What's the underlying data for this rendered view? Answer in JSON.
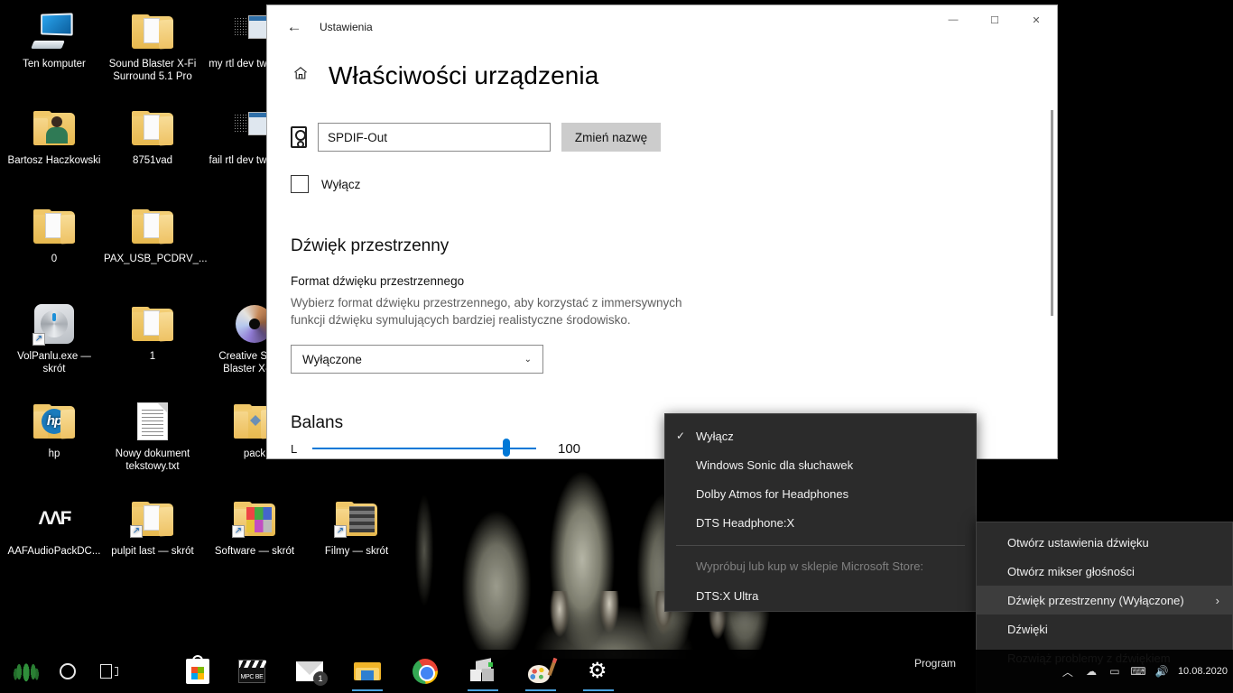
{
  "desktop": {
    "icons": [
      {
        "label": "Ten komputer",
        "type": "pc"
      },
      {
        "label": "Sound Blaster X-Fi Surround 5.1 Pro",
        "type": "folder-papers"
      },
      {
        "label": "my rtl dev tweak.jpg",
        "type": "jpg"
      },
      {
        "label": "Bartosz Haczkowski",
        "type": "folder-person"
      },
      {
        "label": "8751vad",
        "type": "folder-papers"
      },
      {
        "label": "fail  rtl dev tweak.jpg",
        "type": "jpg"
      },
      {
        "label": "0",
        "type": "folder-papers"
      },
      {
        "label": "PAX_USB_PCDRV_...",
        "type": "folder-papers"
      },
      {
        "label": "VolPanlu.exe — skrót",
        "type": "knob-shortcut"
      },
      {
        "label": "1",
        "type": "folder-papers"
      },
      {
        "label": "Creative Sound Blaster X-Fi...",
        "type": "disc"
      },
      {
        "label": "hp",
        "type": "folder-hp"
      },
      {
        "label": "Nowy dokument tekstowy.txt",
        "type": "text"
      },
      {
        "label": "pack",
        "type": "folder-pack"
      },
      {
        "label": "AAFAudioPackDC...",
        "type": "aaf"
      },
      {
        "label": "pulpit last — skrót",
        "type": "folder-shortcut"
      },
      {
        "label": "Software — skrót",
        "type": "folder-color-shortcut"
      },
      {
        "label": "Filmy — skrót",
        "type": "folder-film-shortcut"
      }
    ]
  },
  "settings_window": {
    "title": "Ustawienia",
    "back_icon": "←",
    "home_icon": "home-icon",
    "page_title": "Właściwości urządzenia",
    "minimize_label": "—",
    "maximize_label": "☐",
    "close_label": "✕",
    "device_name_value": "SPDIF-Out",
    "rename_button": "Zmień nazwę",
    "disable_checkbox_label": "Wyłącz",
    "spatial_section_title": "Dźwięk przestrzenny",
    "spatial_field_label": "Format dźwięku przestrzennego",
    "spatial_description": "Wybierz format dźwięku przestrzennego, aby korzystać z immersywnych funkcji dźwięku symulujących bardziej realistyczne środowisko.",
    "spatial_dropdown_value": "Wyłączone",
    "spatial_dropdown_chevron": "⌄",
    "balance_title": "Balans",
    "balance_left_label": "L",
    "balance_value": "100"
  },
  "spatial_menu": {
    "checkmark": "✓",
    "items": [
      {
        "label": "Wyłącz",
        "checked": true
      },
      {
        "label": "Windows Sonic dla słuchawek",
        "checked": false
      },
      {
        "label": "Dolby Atmos for Headphones",
        "checked": false
      },
      {
        "label": "DTS Headphone:X",
        "checked": false
      }
    ],
    "store_header": "Wypróbuj lub kup w sklepie Microsoft Store:",
    "store_items": [
      {
        "label": "DTS:X Ultra"
      }
    ]
  },
  "tray_menu": {
    "items": [
      {
        "label": "Otwórz ustawienia dźwięku",
        "selected": false,
        "submenu": false
      },
      {
        "label": "Otwórz mikser głośności",
        "selected": false,
        "submenu": false
      },
      {
        "label": "Dźwięk przestrzenny (Wyłączone)",
        "selected": true,
        "submenu": true
      },
      {
        "label": "Dźwięki",
        "selected": false,
        "submenu": false
      },
      {
        "label": "Rozwiąż problemy z dźwiękiem",
        "selected": false,
        "submenu": false
      }
    ],
    "submenu_arrow": "›"
  },
  "taskbar": {
    "start_icon": "leaf-start-icon",
    "cortana_icon": "cortana-circle-icon",
    "taskview_icon": "task-view-icon",
    "apps": [
      {
        "name": "microsoft-store",
        "active": false
      },
      {
        "name": "mpc-be-player",
        "active": false,
        "text": "MPC BE"
      },
      {
        "name": "mail",
        "active": false,
        "badge": "1"
      },
      {
        "name": "file-explorer",
        "active": true
      },
      {
        "name": "google-chrome",
        "active": false
      },
      {
        "name": "3d-device-viewer",
        "active": true
      },
      {
        "name": "paint",
        "active": true
      },
      {
        "name": "settings-gear",
        "active": true
      }
    ],
    "program_label": "Program",
    "tray_icons": [
      "show-hidden-icons",
      "onedrive-icon",
      "network-icon",
      "touchpad-icon",
      "volume-icon"
    ],
    "clock_date": "10.08.2020"
  }
}
